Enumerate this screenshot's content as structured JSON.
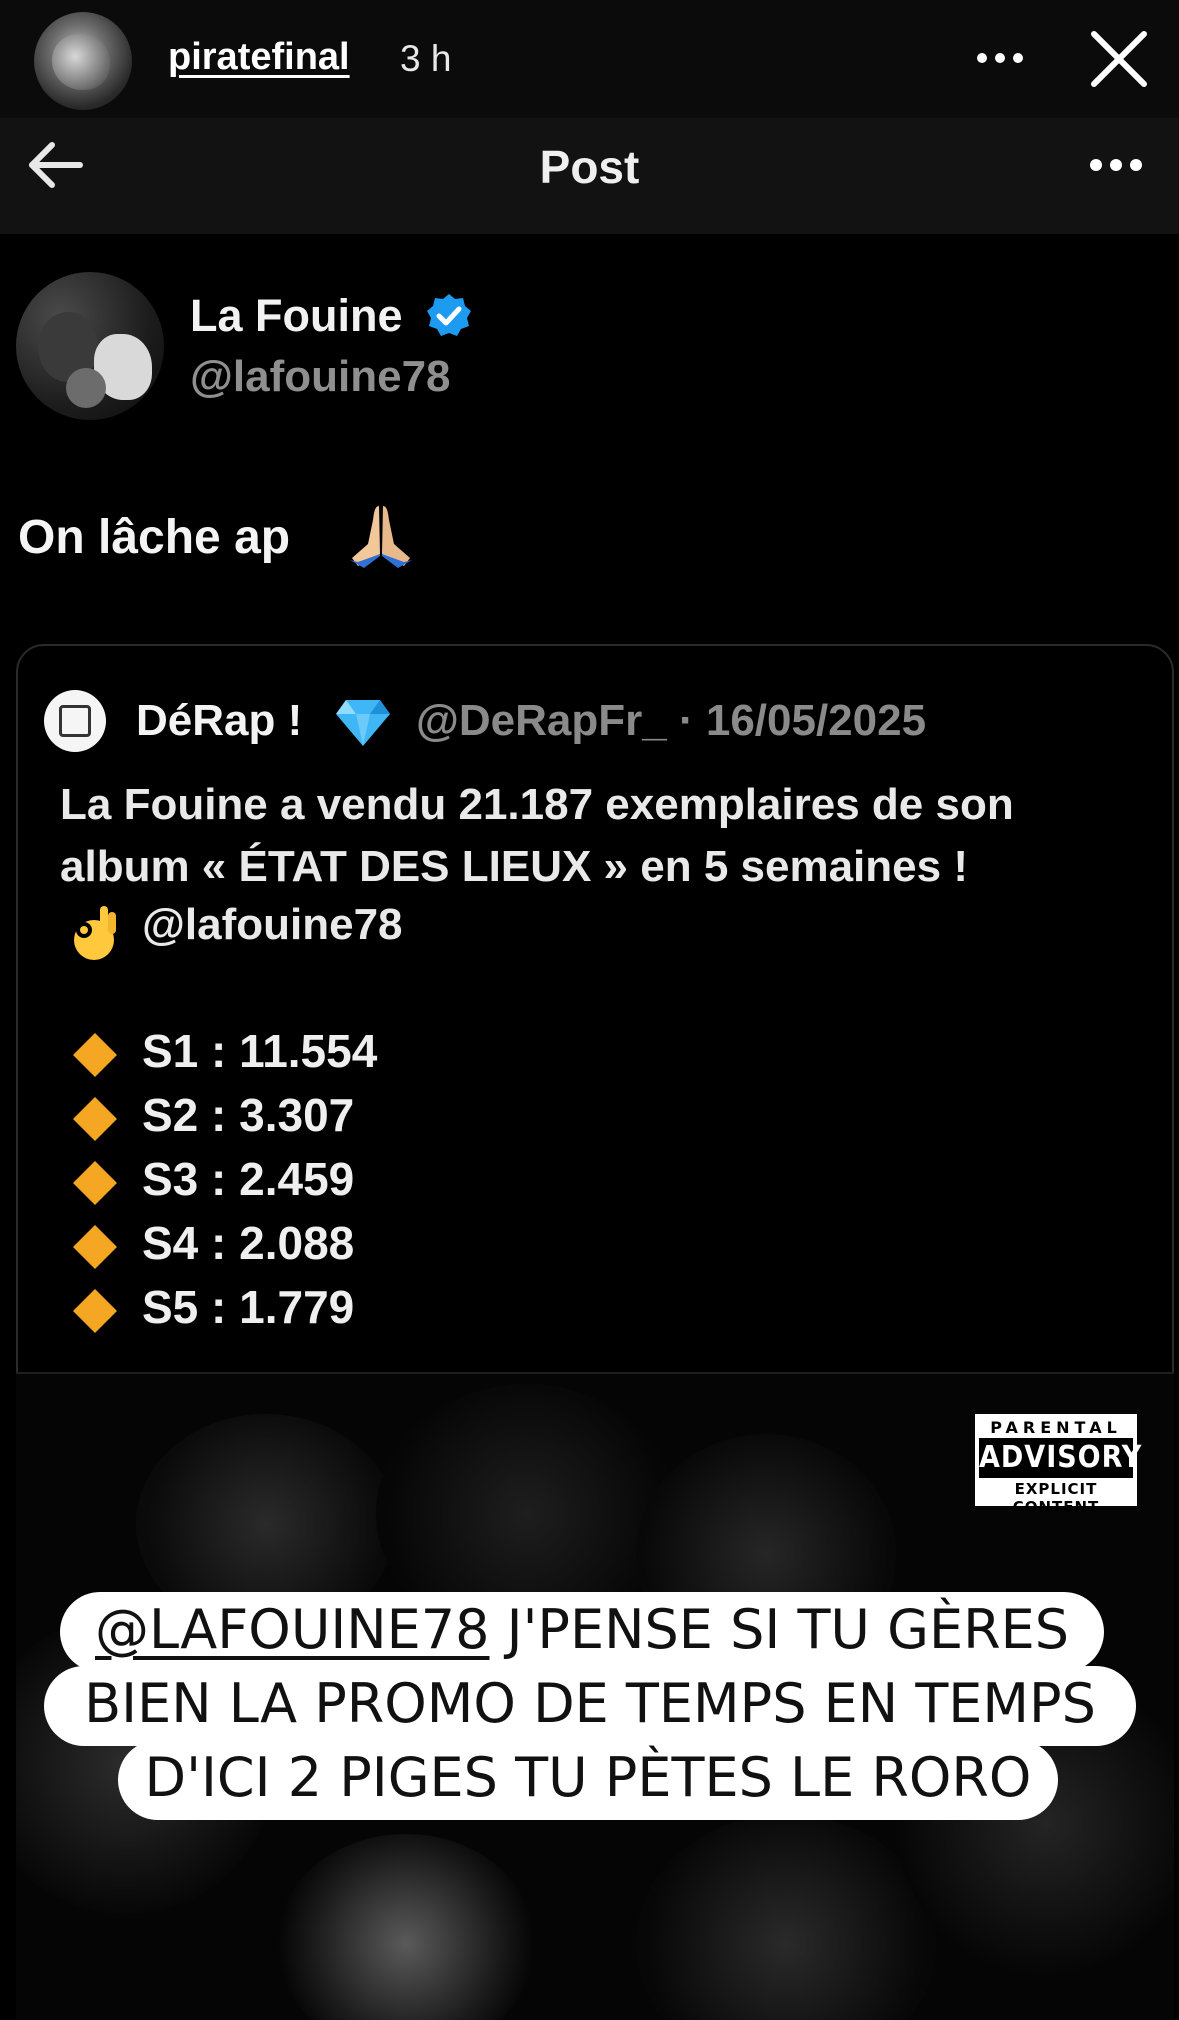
{
  "story": {
    "username": "piratefinal",
    "time": "3 h"
  },
  "post_bar": {
    "title": "Post"
  },
  "author": {
    "name": "La Fouine",
    "handle": "@lafouine78",
    "text": "On lâche ap"
  },
  "quote": {
    "name": "DéRap !",
    "handle_date": "@DeRapFr_ · 16/05/2025",
    "text": "La Fouine a vendu 21.187 exemplaires de son album « ÉTAT DES LIEUX » en 5 semaines !",
    "mention": "@lafouine78",
    "stats": [
      {
        "label": "S1 : 11.554"
      },
      {
        "label": "S2 : 3.307"
      },
      {
        "label": "S3 : 2.459"
      },
      {
        "label": "S4 : 2.088"
      },
      {
        "label": "S5 : 1.779"
      }
    ]
  },
  "advisory": {
    "top": "PARENTAL",
    "middle": "ADVISORY",
    "bottom": "EXPLICIT CONTENT"
  },
  "caption": {
    "mention": "@LAFOUINE78",
    "line1_rest": " J'PENSE SI TU GÈRES",
    "line2": "BIEN LA PROMO DE TEMPS EN TEMPS",
    "line3": "D'ICI 2 PIGES TU PÈTES LE RORO"
  },
  "colors": {
    "verified": "#1d9bf0",
    "diamond_orange": "#f5a623",
    "diamond_blue": "#3fb6f5"
  },
  "icons": [
    "back-arrow-icon",
    "more-icon",
    "close-icon",
    "verified-icon",
    "pray-emoji-icon",
    "gem-emoji-icon",
    "ok-hand-emoji-icon",
    "orange-diamond-icon"
  ]
}
